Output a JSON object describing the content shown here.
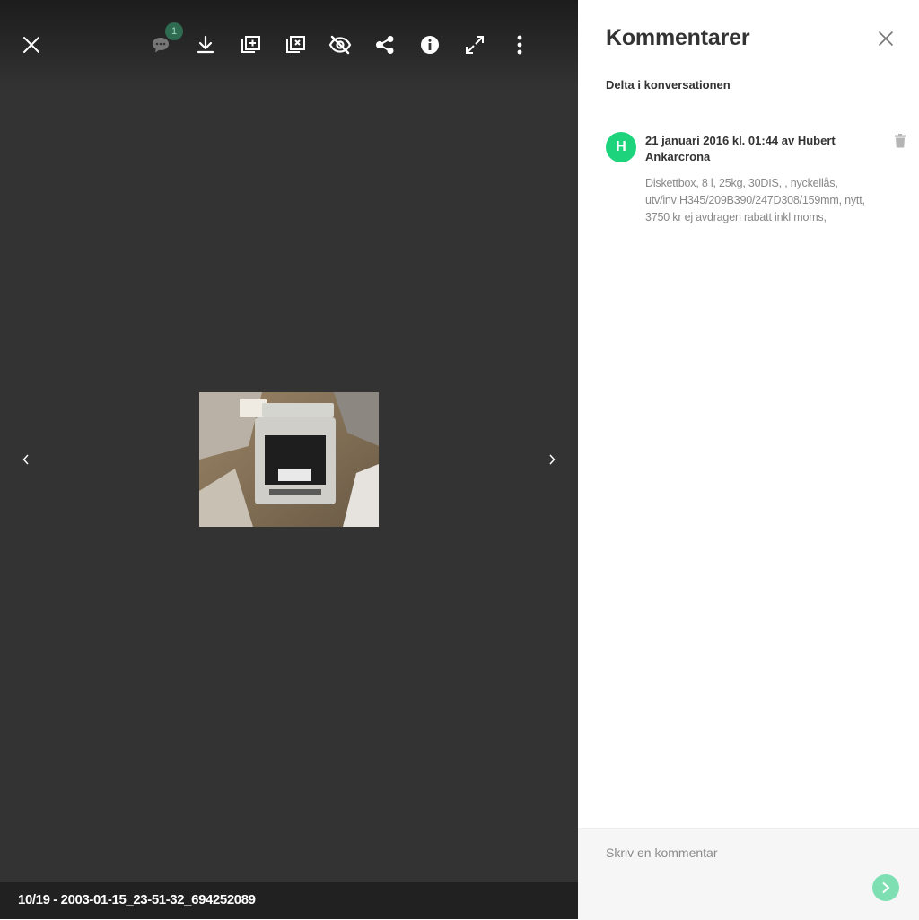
{
  "viewer": {
    "toolbar": {
      "close_icon": "close-icon",
      "comments_icon": "comment-icon",
      "comments_count": "1",
      "download_icon": "download-icon",
      "add_to_album_icon": "add-to-album-icon",
      "remove_from_album_icon": "remove-from-album-icon",
      "hide_icon": "eye-off-icon",
      "share_icon": "share-icon",
      "info_icon": "info-icon",
      "fullscreen_icon": "expand-icon",
      "more_icon": "more-vertical-icon"
    },
    "nav": {
      "prev_icon": "chevron-left-icon",
      "next_icon": "chevron-right-icon"
    },
    "caption": "10/19 - 2003-01-15_23-51-32_694252089",
    "colors": {
      "background": "#333333",
      "caption_bar": "#212121",
      "badge": "#2e6b50"
    }
  },
  "comments_panel": {
    "title": "Kommentarer",
    "subtitle": "Delta i konversationen",
    "close_icon": "close-icon",
    "comments": [
      {
        "avatar_letter": "H",
        "header": "21 januari 2016 kl. 01:44 av Hubert Ankarcrona",
        "body": "Diskettbox, 8 l, 25kg, 30DIS, , nyckellås, utv/inv H345/209B390/247D308/159mm, nytt, 3750 kr ej avdragen rabatt inkl moms,",
        "delete_icon": "trash-icon"
      }
    ],
    "composer": {
      "placeholder": "Skriv en kommentar",
      "value": "",
      "send_icon": "send-icon"
    },
    "colors": {
      "avatar": "#1dd47c",
      "send_button": "#7ee0b2"
    }
  }
}
